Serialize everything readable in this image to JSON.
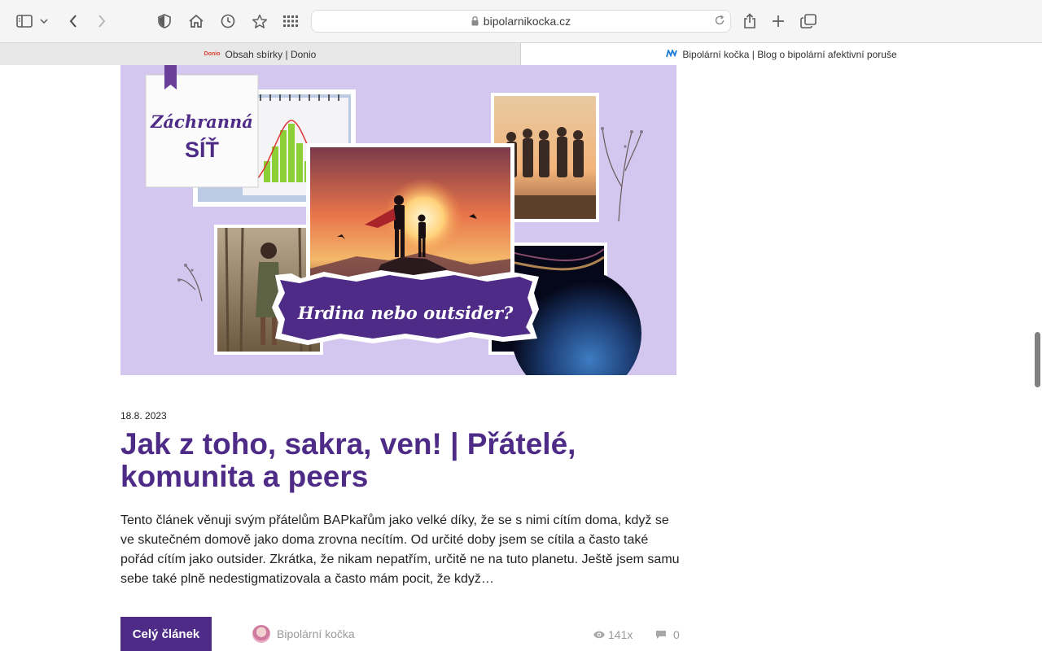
{
  "browser": {
    "url": "bipolarnikocka.cz",
    "tabs": [
      {
        "label": "Obsah sbírky | Donio",
        "favicon": "Donio",
        "active": false
      },
      {
        "label": "Bipolární kočka | Blog o bipolární afektivní poruše",
        "favicon": "N",
        "active": true
      }
    ]
  },
  "hero": {
    "note_line1": "Záchranná",
    "note_line2": "SÍŤ",
    "banner": "Hrdina nebo outsider?"
  },
  "post": {
    "date": "18.8. 2023",
    "title": "Jak z toho, sakra, ven! | Přátelé, komunita a peers",
    "excerpt": "Tento článek věnuji svým přátelům BAPkařům jako velké díky, že se s nimi cítím doma, když se ve skutečném domově jako doma zrovna necítím.  Od určité doby jsem se cítila a často také pořád cítím jako outsider. Zkrátka, že nikam nepatřím, určitě ne na tuto planetu. Ještě jsem samu sebe také plně nedestigmatizovala a často mám pocit, že když…",
    "read_more": "Celý článek",
    "author": "Bipolární kočka",
    "views": "141x",
    "comments": "0"
  },
  "colors": {
    "accent": "#4d2b87",
    "hero_bg": "#d3c7ef"
  }
}
